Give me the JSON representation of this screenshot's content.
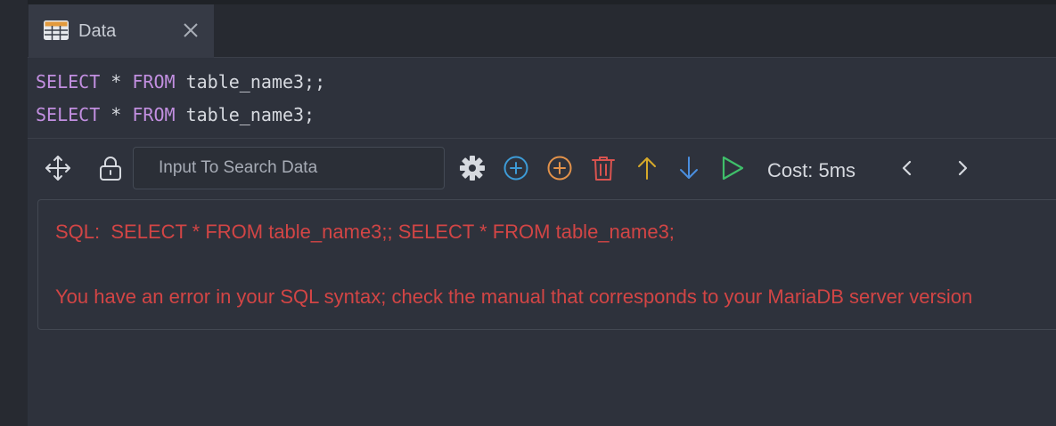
{
  "tab": {
    "icon": "table-icon",
    "label": "Data",
    "close_icon": "close-icon"
  },
  "editor": {
    "lines": [
      {
        "keyword1": "SELECT",
        "mid1": " * ",
        "keyword2": "FROM",
        "rest": " table_name3;;"
      },
      {
        "keyword1": "SELECT",
        "mid1": " * ",
        "keyword2": "FROM",
        "rest": " table_name3;"
      }
    ]
  },
  "toolbar": {
    "move_icon": "move-icon",
    "lock_icon": "lock-icon",
    "search_placeholder": "Input To Search Data",
    "settings_icon": "gear-icon",
    "add_icon": "plus-circle-icon",
    "add_alt_icon": "plus-circle-orange-icon",
    "delete_icon": "trash-icon",
    "up_icon": "arrow-up-icon",
    "down_icon": "arrow-down-icon",
    "run_icon": "play-icon",
    "cost_label": "Cost: 5ms",
    "prev_icon": "chevron-left-icon",
    "next_icon": "chevron-right-icon"
  },
  "result": {
    "sql_line": "SQL:  SELECT * FROM table_name3;; SELECT * FROM table_name3;",
    "error_line": "You have an error in your SQL syntax; check the manual that corresponds to your MariaDB server version"
  },
  "colors": {
    "keyword": "#c28fe0",
    "error": "#d24545",
    "add": "#3d9bd6",
    "add_alt": "#e3924a",
    "delete": "#d9534f",
    "up": "#d6a92a",
    "down": "#4a8fe0",
    "run": "#3fbf6a"
  }
}
